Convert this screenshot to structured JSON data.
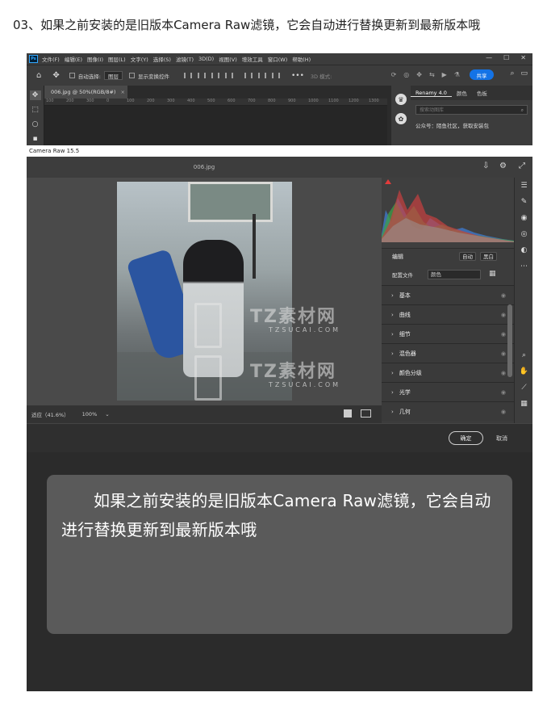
{
  "heading": "03、如果之前安装的是旧版本Camera Raw滤镜，它会自动进行替换更新到最新版本哦",
  "photoshop": {
    "logo": "Ps",
    "menu": [
      "文件(F)",
      "编辑(E)",
      "图像(I)",
      "图层(L)",
      "文字(Y)",
      "选择(S)",
      "滤镜(T)",
      "3D(D)",
      "视图(V)",
      "增效工具",
      "窗口(W)",
      "帮助(H)"
    ],
    "window_controls": [
      "—",
      "☐",
      "✕"
    ],
    "options": {
      "auto_select_label": "自动选择:",
      "auto_select_value": "图层",
      "show_transform_label": "显示变换控件",
      "mode_label": "3D 模式:",
      "share_label": "共享"
    },
    "doc_tab": {
      "title": "006.jpg @ 50%(RGB/8#)",
      "close": "×"
    },
    "ruler_marks": [
      "100",
      "200",
      "300",
      "0",
      "100",
      "200",
      "300",
      "400",
      "500",
      "600",
      "700",
      "800",
      "900",
      "1000",
      "1100",
      "1200",
      "1300"
    ],
    "right_panel": {
      "tabs": [
        "Renamy 4.0",
        "颜色",
        "色板"
      ],
      "search_placeholder": "搜索动图库",
      "note": "公众号：陌鱼社区，获取安装包"
    }
  },
  "camera_raw": {
    "title": "Camera Raw 15.5",
    "filename": "006.jpg",
    "zoom_fit": "适应（41.6%）",
    "zoom_100": "100%",
    "edit_label": "编辑",
    "auto_label": "自动",
    "bw_label": "黑白",
    "profile_label": "配置文件",
    "profile_value": "颜色",
    "sections": [
      "基本",
      "曲线",
      "细节",
      "混色器",
      "颜色分级",
      "光学",
      "几何"
    ],
    "ok_label": "确定",
    "cancel_label": "取消",
    "watermark": {
      "brand": "TZ素材网",
      "domain": "TZSUCAI.COM"
    }
  },
  "caption": "如果之前安装的是旧版本Camera Raw滤镜，它会自动进行替换更新到最新版本哦",
  "colors": {
    "accent": "#1473e6",
    "panel_bg": "#3c3c3c",
    "caption_bg": "#5a5a5a"
  }
}
